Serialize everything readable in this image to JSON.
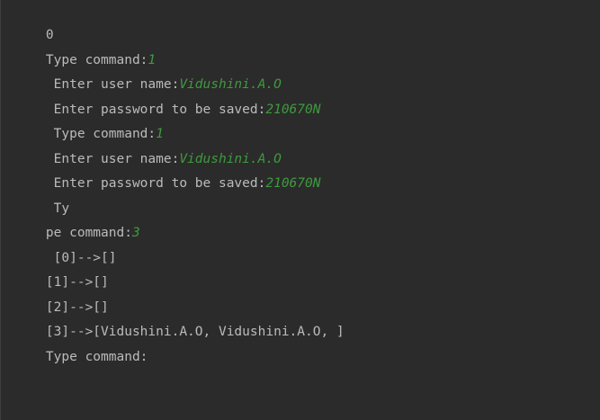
{
  "console": {
    "lines": [
      {
        "text": "0"
      },
      {
        "text": "Type command:",
        "input": "1"
      },
      {
        "text": " Enter user name:",
        "input": "Vidushini.A.O"
      },
      {
        "text": " Enter password to be saved:",
        "input": "210670N"
      },
      {
        "text": " Type command:",
        "input": "1"
      },
      {
        "text": " Enter user name:",
        "input": "Vidushini.A.O"
      },
      {
        "text": " Enter password to be saved:",
        "input": "210670N"
      },
      {
        "text": " Ty"
      },
      {
        "text": "pe command:",
        "input": "3"
      },
      {
        "text": " [0]-->[]"
      },
      {
        "text": "[1]-->[]"
      },
      {
        "text": "[2]-->[]"
      },
      {
        "text": "[3]-->[Vidushini.A.O, Vidushini.A.O, ]"
      },
      {
        "text": "Type command:",
        "input": ""
      }
    ]
  },
  "colors": {
    "background": "#2b2b2b",
    "output_text": "#bbbbbb",
    "user_input": "#3e9a3e"
  }
}
